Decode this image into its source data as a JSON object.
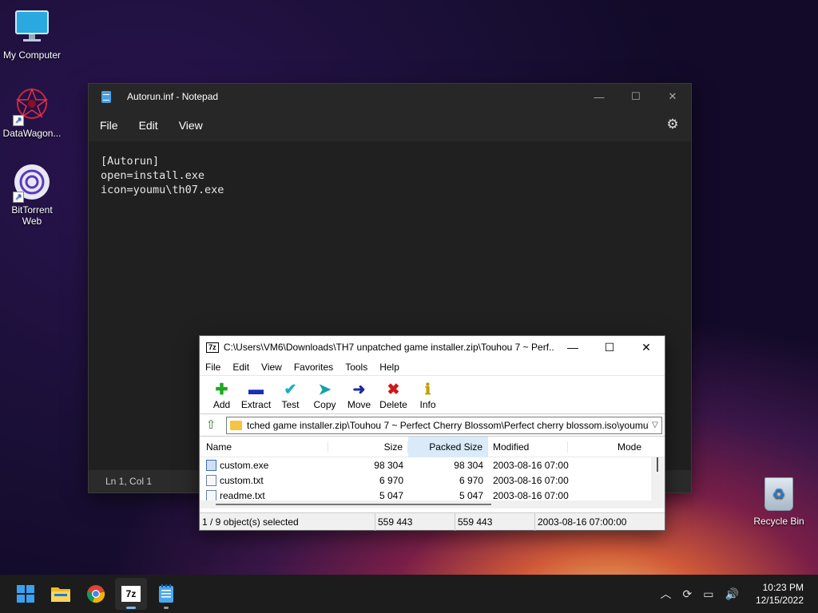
{
  "desktop": {
    "icons": [
      {
        "label": "My Computer"
      },
      {
        "label": "DataWagon..."
      },
      {
        "label": "BitTorrent Web"
      },
      {
        "label": "Recycle Bin"
      }
    ]
  },
  "notepad": {
    "title": "Autorun.inf - Notepad",
    "menu": [
      "File",
      "Edit",
      "View"
    ],
    "content": "[Autorun]\nopen=install.exe\nicon=youmu\\th07.exe",
    "status": "Ln 1, Col 1"
  },
  "sevenzip": {
    "title": "C:\\Users\\VM6\\Downloads\\TH7 unpatched game installer.zip\\Touhou 7 ~ Perf...",
    "menu": [
      "File",
      "Edit",
      "View",
      "Favorites",
      "Tools",
      "Help"
    ],
    "toolbar": [
      {
        "label": "Add",
        "icon": "plus",
        "color": "#1fa81f"
      },
      {
        "label": "Extract",
        "icon": "minus",
        "color": "#1a2fb8"
      },
      {
        "label": "Test",
        "icon": "check",
        "color": "#18b0c0"
      },
      {
        "label": "Copy",
        "icon": "double-arrow",
        "color": "#18a0a8"
      },
      {
        "label": "Move",
        "icon": "arrow-right",
        "color": "#1a2a9a"
      },
      {
        "label": "Delete",
        "icon": "x",
        "color": "#d01818"
      },
      {
        "label": "Info",
        "icon": "info",
        "color": "#c0a000"
      }
    ],
    "address": "tched game installer.zip\\Touhou 7 ~ Perfect Cherry Blossom\\Perfect cherry blossom.iso\\youmu\\",
    "columns": {
      "name": "Name",
      "size": "Size",
      "packed": "Packed Size",
      "modified": "Modified",
      "mode": "Mode"
    },
    "files": [
      {
        "name": "custom.exe",
        "size": "98 304",
        "packed": "98 304",
        "modified": "2003-08-16 07:00",
        "type": "exe"
      },
      {
        "name": "custom.txt",
        "size": "6 970",
        "packed": "6 970",
        "modified": "2003-08-16 07:00",
        "type": "txt"
      },
      {
        "name": "readme.txt",
        "size": "5 047",
        "packed": "5 047",
        "modified": "2003-08-16 07:00",
        "type": "txt"
      }
    ],
    "status": {
      "selected": "1 / 9 object(s) selected",
      "size": "559 443",
      "packed": "559 443",
      "modified": "2003-08-16 07:00:00"
    }
  },
  "taskbar": {
    "apps": [
      "start",
      "file-explorer",
      "chrome",
      "7zip",
      "notepad"
    ],
    "time": "10:23 PM",
    "date": "12/15/2022"
  }
}
